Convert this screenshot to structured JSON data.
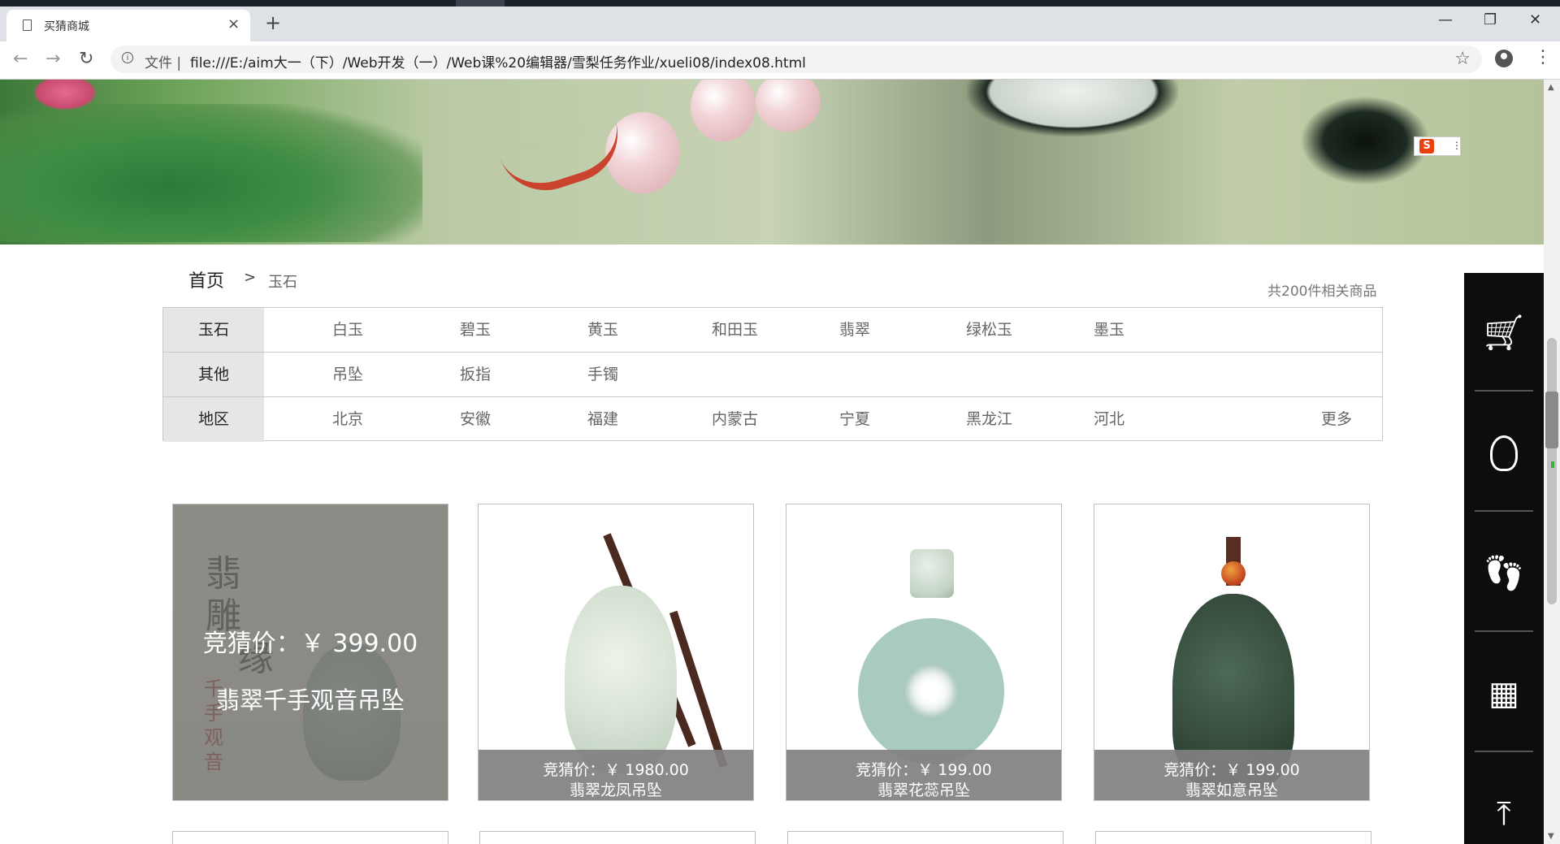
{
  "browser": {
    "tab_title": "买猜商城",
    "tab_close": "×",
    "new_tab": "+",
    "win_minimize": "—",
    "win_restore": "❐",
    "win_close": "✕",
    "back": "←",
    "forward": "→",
    "reload": "↻",
    "scheme_label": "文件 |",
    "url": "file:///E:/aim大一（下）/Web开发（一）/Web课%20编辑器/雪梨任务作业/xueli08/index08.html",
    "star": "☆",
    "menu": "⋮",
    "info_icon": "i"
  },
  "banner": {
    "ime_badge": "S",
    "ime_dots": "⋮"
  },
  "breadcrumb": {
    "home": "首页",
    "separator": ">",
    "current": "玉石",
    "count": "共200件相关商品"
  },
  "filters": [
    {
      "head": "玉石",
      "options": [
        "白玉",
        "碧玉",
        "黄玉",
        "和田玉",
        "翡翠",
        "绿松玉",
        "墨玉"
      ],
      "more": ""
    },
    {
      "head": "其他",
      "options": [
        "吊坠",
        "扳指",
        "手镯"
      ],
      "more": ""
    },
    {
      "head": "地区",
      "options": [
        "北京",
        "安徽",
        "福建",
        "内蒙古",
        "宁夏",
        "黑龙江",
        "河北"
      ],
      "more": "更多"
    }
  ],
  "products": [
    {
      "price": "竞猜价：￥   399.00",
      "name": "翡翠千手观音吊坠",
      "hover": true,
      "art_text": [
        "翡",
        "雕",
        "缘",
        "千",
        "手",
        "观",
        "音"
      ]
    },
    {
      "price": "竞猜价：￥  1980.00",
      "name": "翡翠龙凤吊坠",
      "hover": false
    },
    {
      "price": "竞猜价：￥   199.00",
      "name": "翡翠花蕊吊坠",
      "hover": false
    },
    {
      "price": "竞猜价：￥   199.00",
      "name": "翡翠如意吊坠",
      "hover": false
    }
  ],
  "sidebar": [
    {
      "name": "cart-icon",
      "glyph": "🛒"
    },
    {
      "name": "qq-icon",
      "glyph": "◠"
    },
    {
      "name": "footprint-icon",
      "glyph": "👣"
    },
    {
      "name": "qrcode-icon",
      "glyph": "▦"
    },
    {
      "name": "back-to-top-icon",
      "glyph": "⤒"
    }
  ],
  "scrollbar": {
    "up": "▲",
    "down": "▼"
  }
}
